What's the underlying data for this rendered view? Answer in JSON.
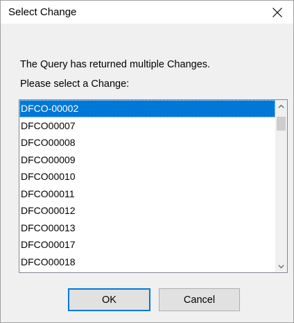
{
  "dialog": {
    "title": "Select Change",
    "message_line1": "The Query has returned multiple Changes.",
    "message_line2": "Please select a Change:",
    "close_icon": "close-icon"
  },
  "list": {
    "selected_index": 0,
    "items": [
      "DFCO-00002",
      "DFCO00007",
      "DFCO00008",
      "DFCO00009",
      "DFCO00010",
      "DFCO00011",
      "DFCO00012",
      "DFCO00013",
      "DFCO00017",
      "DFCO00018"
    ]
  },
  "buttons": {
    "ok_label": "OK",
    "cancel_label": "Cancel"
  },
  "colors": {
    "selection": "#0078d7",
    "dialog_background": "#f0f0f0",
    "titlebar_background": "#ffffff"
  }
}
